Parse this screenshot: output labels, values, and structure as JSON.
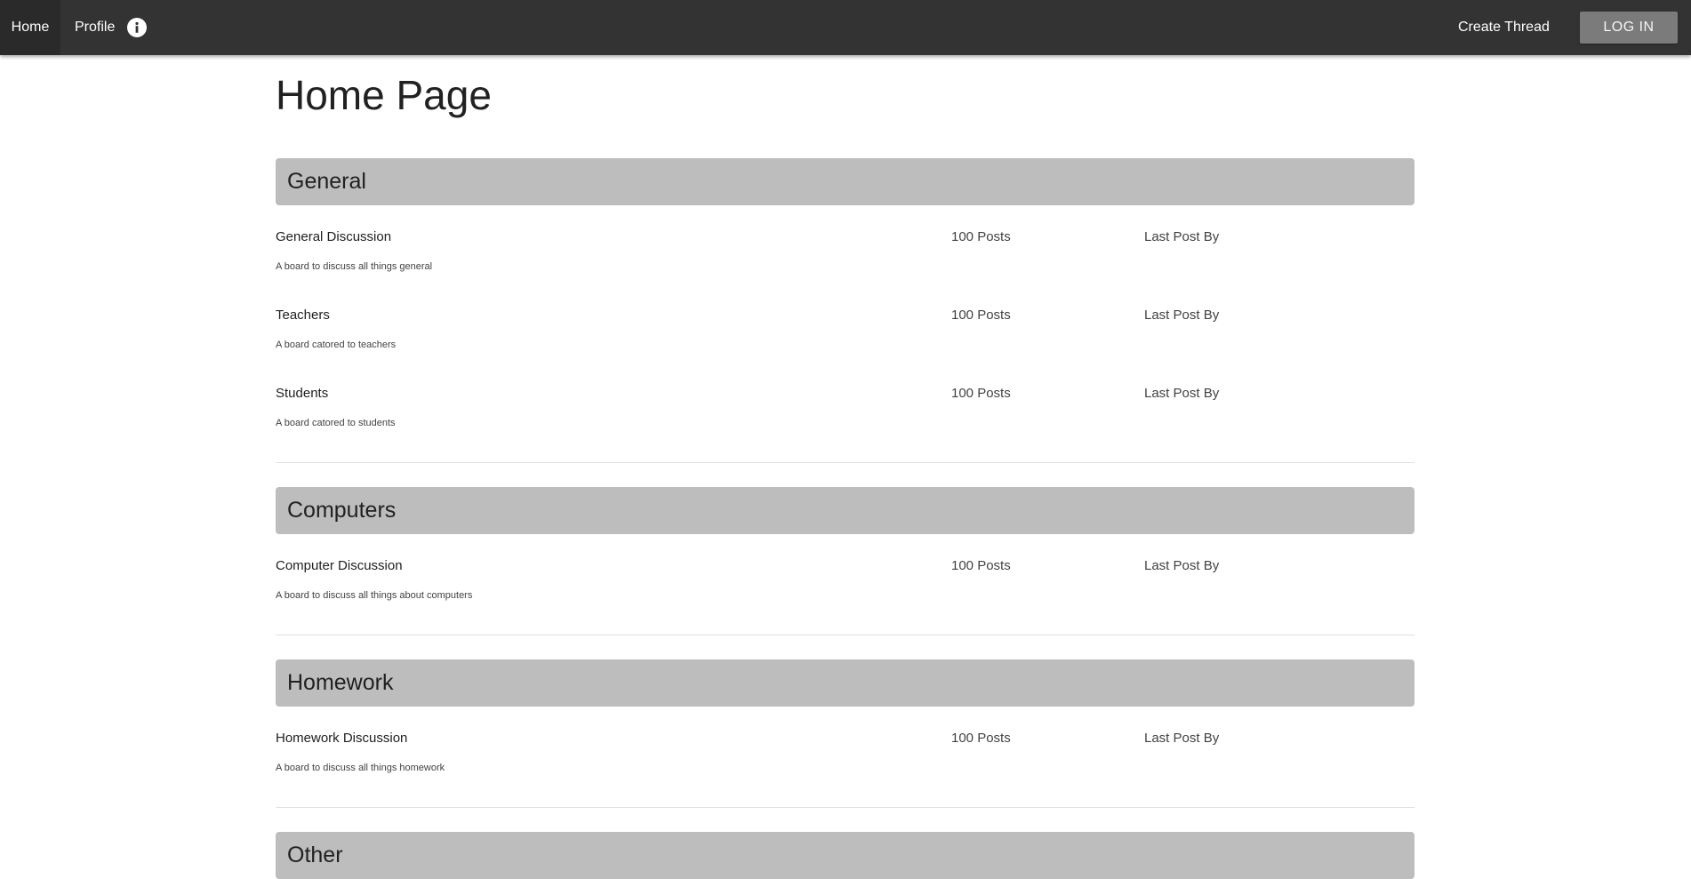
{
  "nav": {
    "home_label": "Home",
    "profile_label": "Profile",
    "info_icon": "info-icon",
    "create_thread_label": "Create Thread",
    "login_label": "LOG IN"
  },
  "page": {
    "title": "Home Page"
  },
  "categories": [
    {
      "title": "General",
      "boards": [
        {
          "name": "General Discussion",
          "description": "A board to discuss all things general",
          "posts": "100 Posts",
          "last_post": "Last Post By"
        },
        {
          "name": "Teachers",
          "description": "A board catored to teachers",
          "posts": "100 Posts",
          "last_post": "Last Post By"
        },
        {
          "name": "Students",
          "description": "A board catored to students",
          "posts": "100 Posts",
          "last_post": "Last Post By"
        }
      ]
    },
    {
      "title": "Computers",
      "boards": [
        {
          "name": "Computer Discussion",
          "description": "A board to discuss all things about computers",
          "posts": "100 Posts",
          "last_post": "Last Post By"
        }
      ]
    },
    {
      "title": "Homework",
      "boards": [
        {
          "name": "Homework Discussion",
          "description": "A board to discuss all things homework",
          "posts": "100 Posts",
          "last_post": "Last Post By"
        }
      ]
    },
    {
      "title": "Other",
      "boards": []
    }
  ],
  "colors": {
    "topbar": "#333334",
    "category_header": "#bdbdbd",
    "login_button": "#7b7b7b"
  }
}
